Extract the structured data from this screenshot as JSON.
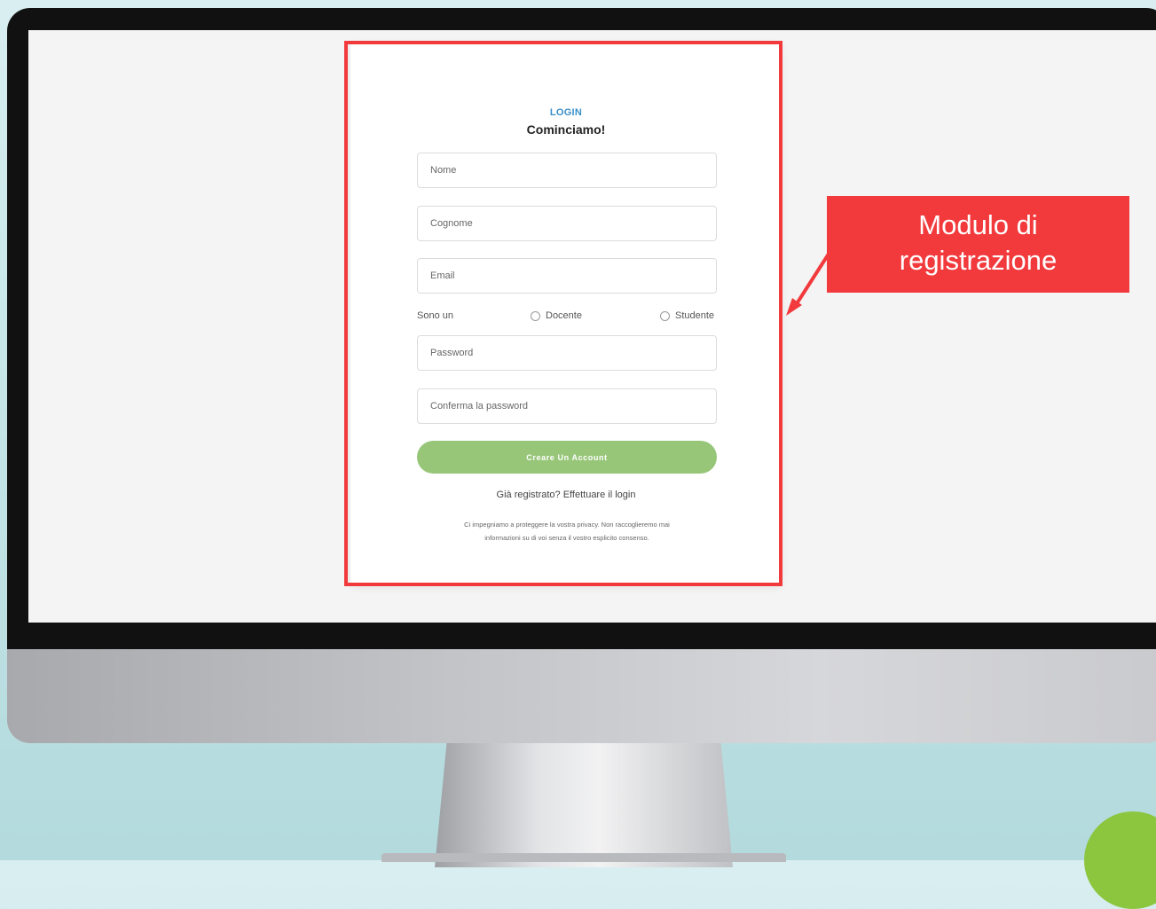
{
  "form": {
    "login_label": "LOGIN",
    "title": "Cominciamo!",
    "fields": {
      "first_name_placeholder": "Nome",
      "last_name_placeholder": "Cognome",
      "email_placeholder": "Email",
      "password_placeholder": "Password",
      "confirm_password_placeholder": "Conferma la password"
    },
    "role": {
      "label": "Sono un",
      "option_teacher": "Docente",
      "option_student": "Studente"
    },
    "submit_label": "Creare Un Account",
    "login_link": "Già registrato? Effettuare il login",
    "privacy_note": "Ci impegniamo a proteggere la vostra privacy. Non raccoglieremo mai informazioni su di voi senza il vostro esplicito consenso."
  },
  "annotation": {
    "line1": "Modulo di",
    "line2": "registrazione",
    "color": "#f23a3d"
  },
  "colors": {
    "button": "#97c679",
    "login_label": "#3a8fc8",
    "accent_dot": "#8cc63f"
  }
}
